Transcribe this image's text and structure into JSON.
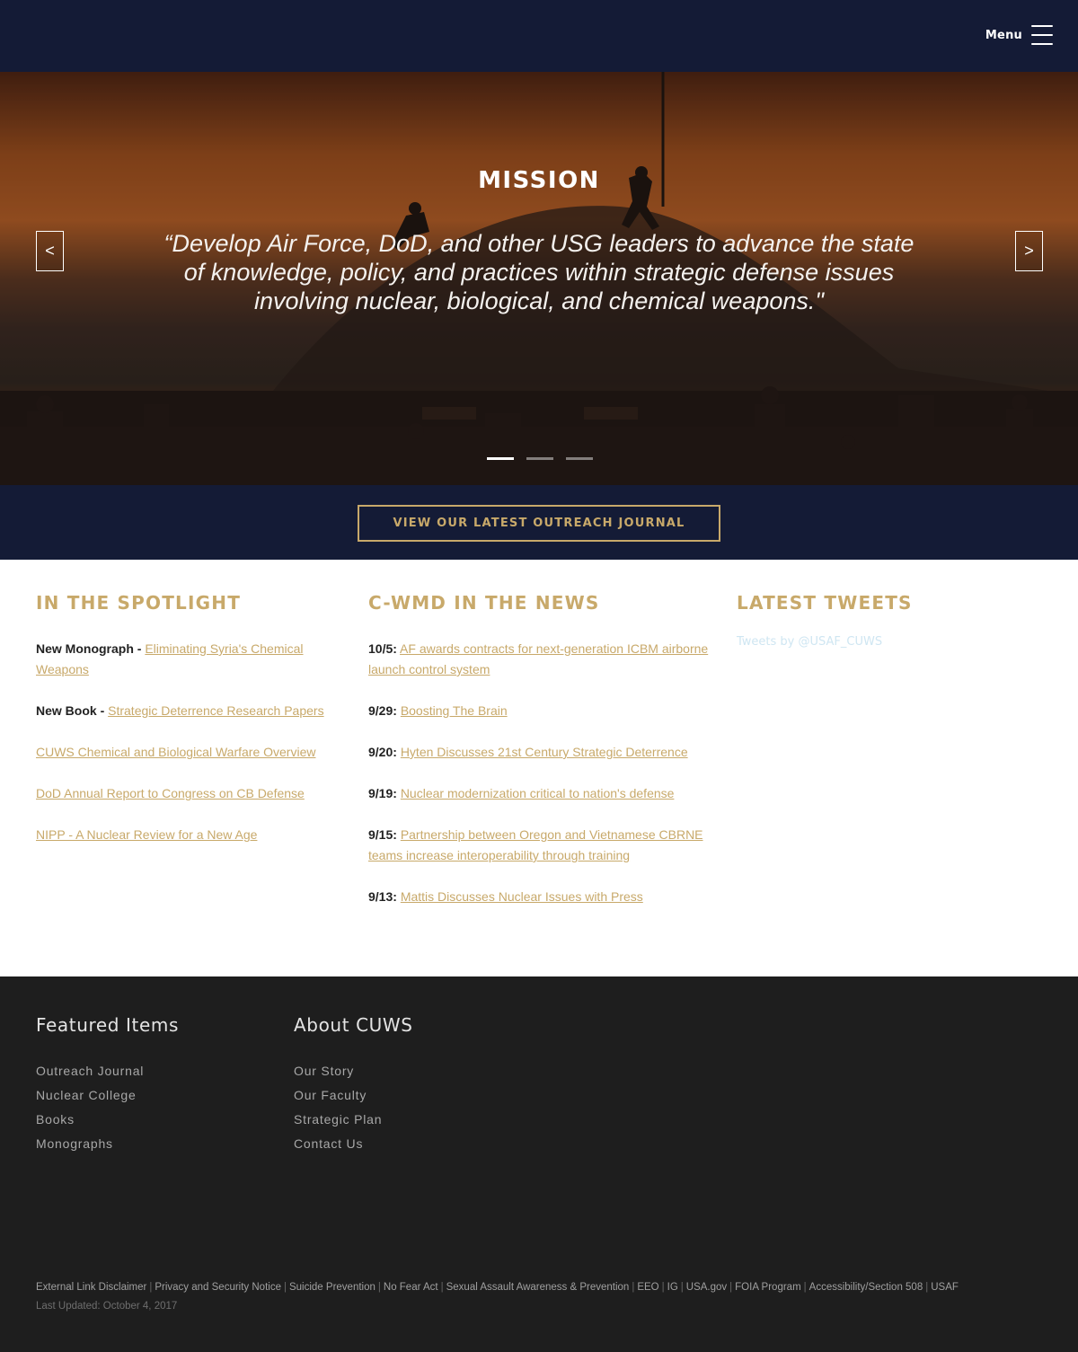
{
  "header": {
    "menu_label": "Menu"
  },
  "hero": {
    "title": "MISSION",
    "quote": "“Develop Air Force, DoD, and other USG leaders to advance the state of knowledge, policy, and practices within strategic defense issues involving nuclear, biological, and chemical weapons.\"",
    "prev_label": "<",
    "next_label": ">",
    "slide_count": 3,
    "active_slide": 1
  },
  "cta": {
    "label": "VIEW OUR LATEST OUTREACH JOURNAL"
  },
  "spotlight": {
    "heading": "IN THE SPOTLIGHT",
    "items": [
      {
        "prefix": "New Monograph - ",
        "link": "Eliminating Syria's Chemical Weapons"
      },
      {
        "prefix": "New Book - ",
        "link": "Strategic Deterrence Research Papers"
      },
      {
        "prefix": "",
        "link": "CUWS Chemical and Biological Warfare Overview"
      },
      {
        "prefix": "",
        "link": "DoD Annual Report to Congress on CB Defense"
      },
      {
        "prefix": "",
        "link": "NIPP - A Nuclear Review for a New Age"
      }
    ]
  },
  "news": {
    "heading": "C-WMD IN THE NEWS",
    "items": [
      {
        "date": "10/5:",
        "link": "AF awards contracts for next-generation ICBM airborne launch control system"
      },
      {
        "date": "9/29:",
        "link": "Boosting The Brain"
      },
      {
        "date": "9/20:",
        "link": "Hyten Discusses 21st Century Strategic Deterrence"
      },
      {
        "date": "9/19:",
        "link": "Nuclear modernization critical to nation's defense"
      },
      {
        "date": "9/15:",
        "link": "Partnership between Oregon and Vietnamese CBRNE teams increase interoperability through training"
      },
      {
        "date": "9/13:",
        "link": "Mattis Discusses Nuclear Issues with Press"
      }
    ]
  },
  "tweets": {
    "heading": "LATEST TWEETS",
    "link": "Tweets by @USAF_CUWS"
  },
  "footer": {
    "featured": {
      "heading": "Featured Items",
      "links": [
        "Outreach Journal",
        "Nuclear College",
        "Books",
        "Monographs"
      ]
    },
    "about": {
      "heading": "About CUWS",
      "links": [
        "Our Story",
        "Our Faculty",
        "Strategic Plan",
        "Contact Us"
      ]
    },
    "legal_links": [
      "External Link Disclaimer",
      "Privacy and Security Notice",
      "Suicide Prevention",
      "No Fear Act",
      "Sexual Assault Awareness & Prevention",
      "EEO",
      "IG",
      "USA.gov",
      "FOIA Program",
      "Accessibility/Section 508",
      "USAF"
    ],
    "legal_separator": "|",
    "last_updated": "Last Updated: October 4, 2017"
  },
  "colors": {
    "navy": "#141b36",
    "gold": "#c8a96a",
    "footer_bg": "#1e1e1e"
  }
}
